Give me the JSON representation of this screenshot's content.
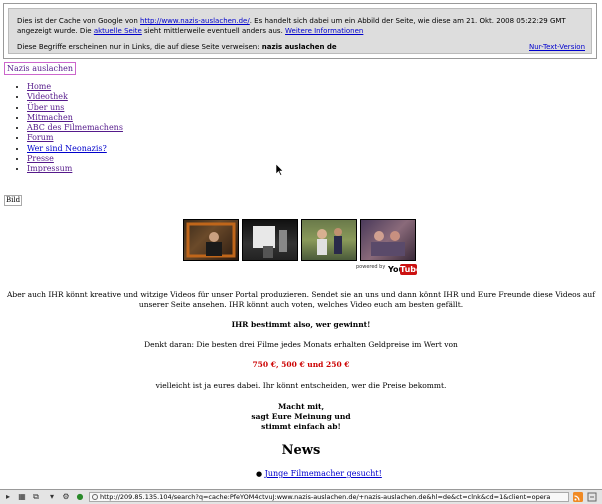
{
  "cache": {
    "text_before_link": "Dies ist der Cache von Google von ",
    "link": "http://www.nazis-auslachen.de/",
    "text_after_link": ". Es handelt sich dabei um ein Abbild der Seite, wie diese am 21. Okt. 2008 05:22:29 GMT angezeigt wurde. Die ",
    "current_page_link": "aktuelle Seite",
    "text_after_current": " sieht mittlerweile eventuell anders aus. ",
    "more_info_link": "Weitere Informationen",
    "terms_text": "Diese Begriffe erscheinen nur in Links, die auf diese Seite verweisen: ",
    "terms_bold": "nazis auslachen de",
    "text_only_link": "Nur-Text-Version"
  },
  "site_title": "Nazis auslachen",
  "nav": [
    "Home",
    "Videothek",
    "Über uns",
    "Mitmachen",
    "ABC des Filmemachens",
    "Forum",
    "Wer sind Neonazis?",
    "Presse",
    "Impressum"
  ],
  "bild_label": "Bild",
  "powered_by": "powered by",
  "yt_you": "You",
  "yt_tube": "Tube",
  "intro": "Aber auch IHR könnt kreative und witzige Videos für unser Portal produzieren. Sendet sie an uns und dann könnt IHR und Eure Freunde diese Videos auf unserer Seite ansehen. IHR könnt auch voten, welches Video euch am besten gefällt.",
  "who_wins": "IHR bestimmt also, wer gewinnt!",
  "reminder": "Denkt daran: Die besten drei Filme jedes Monats erhalten Geldpreise im Wert von",
  "prizes": "750 €, 500 € und 250 €",
  "maybe_you": "vielleicht ist ja eures dabei. Ihr könnt entscheiden, wer die Preise bekommt.",
  "cta_line1": "Macht mit,",
  "cta_line2": "sagt Eure Meinung und",
  "cta_line3": "stimmt einfach ab!",
  "news_heading": "News",
  "news_item": "Junge Filmemacher gesucht!",
  "status_url": "http://209.85.135.104/search?q=cache:PfeYOM4ctvuJ:www.nazis-auslachen.de/+nazis-auslachen.de&hl=de&ct=clnk&cd=1&client=opera"
}
